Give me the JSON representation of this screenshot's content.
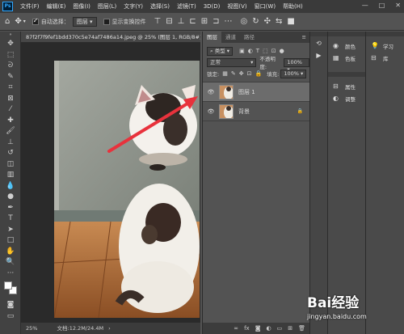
{
  "menubar": {
    "logo": "Ps",
    "items": [
      "文件(F)",
      "编辑(E)",
      "图像(I)",
      "图层(L)",
      "文字(Y)",
      "选择(S)",
      "滤镜(T)",
      "3D(D)",
      "视图(V)",
      "窗口(W)",
      "帮助(H)"
    ],
    "controls": [
      "—",
      "□",
      "✕"
    ]
  },
  "options": {
    "auto_select_label": "自动选择：",
    "auto_select_value": "图层",
    "show_transform_label": "显示变换控件"
  },
  "document": {
    "tab_title": "87f2f7f9fef1bdd370c5e74af7486a14.jpeg @ 25% (图层 1, RGB/8#) *",
    "tab_close": "×",
    "zoom": "25%",
    "doc_info": "文档:12.2M/24.4M"
  },
  "layers_panel": {
    "tabs": [
      "图层",
      "通道",
      "路径"
    ],
    "filter_kind": "类型",
    "blend_mode": "正常",
    "opacity_label": "不透明度:",
    "opacity_value": "100%",
    "lock_label": "锁定:",
    "fill_label": "填充:",
    "fill_value": "100%",
    "layers": [
      {
        "name": "图层 1",
        "selected": true
      },
      {
        "name": "背景",
        "selected": false,
        "locked": true
      }
    ],
    "bottom_icons": [
      "link",
      "fx",
      "mask",
      "adjust",
      "group",
      "new",
      "trash"
    ]
  },
  "side_panels": {
    "col1": [
      {
        "icon": "color-wheel-icon",
        "label": "颜色"
      },
      {
        "icon": "swatches-icon",
        "label": "色板"
      },
      {
        "icon": "properties-icon",
        "label": "属性"
      },
      {
        "icon": "adjustments-icon",
        "label": "调整"
      }
    ],
    "col2": [
      {
        "icon": "lightbulb-icon",
        "label": "学习"
      },
      {
        "icon": "library-icon",
        "label": "库"
      }
    ]
  },
  "watermark": {
    "text": "Bai经验",
    "url": "jingyan.baidu.com"
  },
  "colors": {
    "arrow": "#e8323c",
    "selected_layer": "#6c6c6c"
  }
}
